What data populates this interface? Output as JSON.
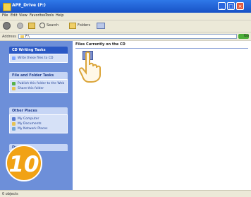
{
  "window": {
    "title": "APE_Drive (F:)",
    "buttons": {
      "minimize": "_",
      "maximize": "□",
      "close": "×"
    }
  },
  "menu": [
    "File",
    "Edit",
    "View",
    "Favorites",
    "Tools",
    "Help"
  ],
  "toolbar": {
    "search_label": "Search",
    "folders_label": "Folders"
  },
  "address": {
    "label": "Address",
    "value": "F:\\",
    "go_label": "Go"
  },
  "sidebar": {
    "panels": [
      {
        "title": "CD Writing Tasks",
        "items": [
          "Write these files to CD"
        ]
      },
      {
        "title": "File and Folder Tasks",
        "items": [
          "Publish this folder to the Web",
          "Share this folder"
        ]
      },
      {
        "title": "Other Places",
        "items": [
          "My Computer",
          "My Documents",
          "My Network Places"
        ]
      },
      {
        "title": "Details",
        "items": []
      }
    ]
  },
  "content": {
    "section_title": "Files Currently on the CD"
  },
  "status": {
    "text": "0 objects"
  },
  "step": {
    "number": "10"
  }
}
